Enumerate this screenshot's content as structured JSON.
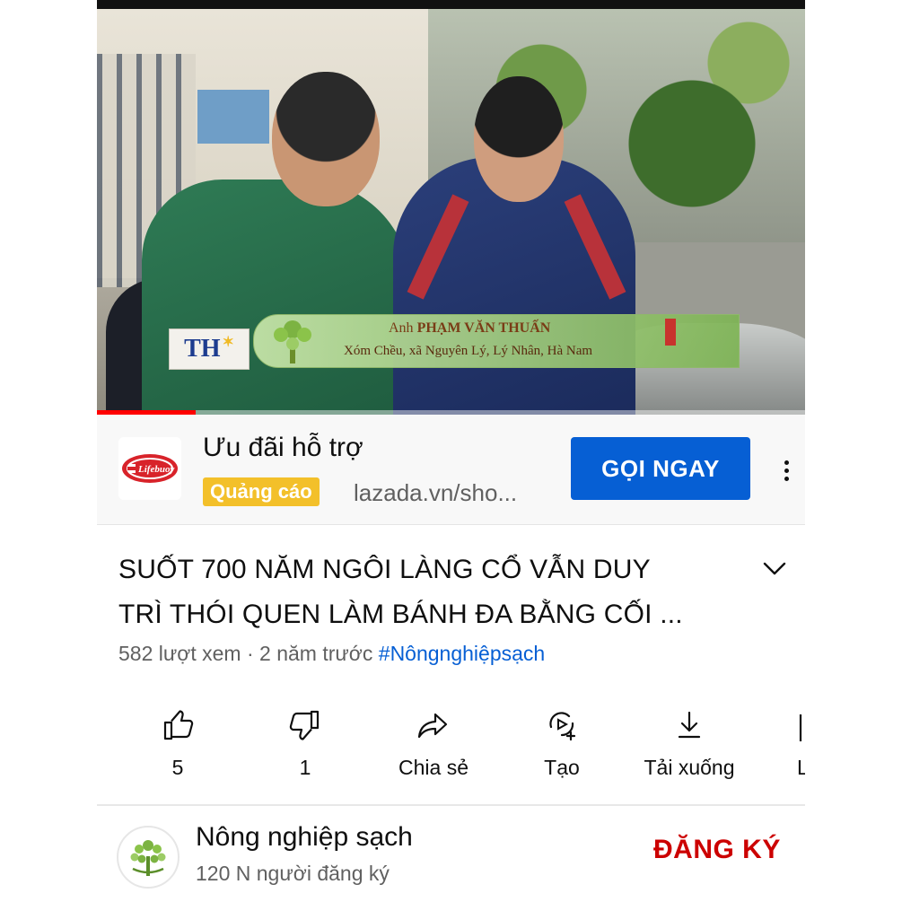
{
  "video": {
    "lower_third": {
      "logo_text": "TH",
      "name_prefix": "Anh",
      "name": "PHẠM VĂN THUẤN",
      "place": "Xóm Chều, xã Nguyên Lý, Lý Nhân, Hà Nam"
    },
    "progress_fraction": 0.14,
    "progress_color": "#ff0000"
  },
  "ad": {
    "logo_text": "Lifebuoy",
    "title": "Ưu đãi hỗ trợ",
    "badge": "Quảng cáo",
    "url": "lazada.vn/sho...",
    "cta_label": "GỌI NGAY",
    "more_icon": "more-vert-icon",
    "cta_color": "#065fd4",
    "badge_color": "#f3c02a"
  },
  "title": {
    "line1": "SUỐT 700 NĂM NGÔI LÀNG CỔ VẪN DUY",
    "line2": "TRÌ THÓI QUEN LÀM BÁNH ĐA BẰNG CỐI ...",
    "expand_icon": "chevron-down-icon"
  },
  "meta": {
    "views": "582 lượt xem",
    "separator": " · ",
    "age": "2 năm trước",
    "hashtag": "#Nôngnghiệpsạch"
  },
  "actions": [
    {
      "icon": "thumbs-up-icon",
      "label": "5"
    },
    {
      "icon": "thumbs-down-icon",
      "label": "1"
    },
    {
      "icon": "share-icon",
      "label": "Chia sẻ"
    },
    {
      "icon": "remix-icon",
      "label": "Tạo"
    },
    {
      "icon": "download-icon",
      "label": "Tải xuống"
    },
    {
      "icon": "save-icon",
      "label": "L"
    }
  ],
  "channel": {
    "name": "Nông nghiệp sạch",
    "subscribers": "120 N người đăng ký",
    "subscribe_label": "ĐĂNG KÝ",
    "subscribe_color": "#cc0000"
  }
}
